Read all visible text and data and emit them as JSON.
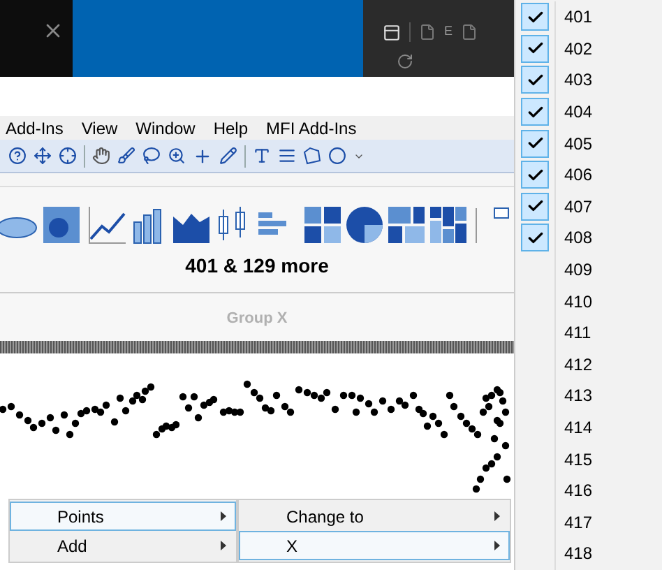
{
  "top_bar": {
    "tab_letter": "E"
  },
  "menu_bar": [
    "Add-Ins",
    "View",
    "Window",
    "Help",
    "MFI Add-Ins"
  ],
  "ribbon": {
    "selection_label": "401 & 129 more",
    "group_label": "Group X",
    "group_disabled": true
  },
  "context_menu": [
    {
      "label": "Points",
      "selected": true,
      "has_submenu": true
    },
    {
      "label": "Add",
      "selected": false,
      "has_submenu": true
    }
  ],
  "submenu": [
    {
      "label": "Change to",
      "selected": false,
      "has_submenu": true
    },
    {
      "label": "X",
      "selected": true,
      "has_submenu": true
    }
  ],
  "checklist": [
    {
      "label": "401",
      "checked": true
    },
    {
      "label": "402",
      "checked": true
    },
    {
      "label": "403",
      "checked": true
    },
    {
      "label": "404",
      "checked": true
    },
    {
      "label": "405",
      "checked": true
    },
    {
      "label": "406",
      "checked": true
    },
    {
      "label": "407",
      "checked": true
    },
    {
      "label": "408",
      "checked": true
    },
    {
      "label": "409",
      "checked": false
    },
    {
      "label": "410",
      "checked": false
    },
    {
      "label": "411",
      "checked": false
    },
    {
      "label": "412",
      "checked": false
    },
    {
      "label": "413",
      "checked": false
    },
    {
      "label": "414",
      "checked": false
    },
    {
      "label": "415",
      "checked": false
    },
    {
      "label": "416",
      "checked": false
    },
    {
      "label": "417",
      "checked": false
    },
    {
      "label": "418",
      "checked": false
    }
  ]
}
